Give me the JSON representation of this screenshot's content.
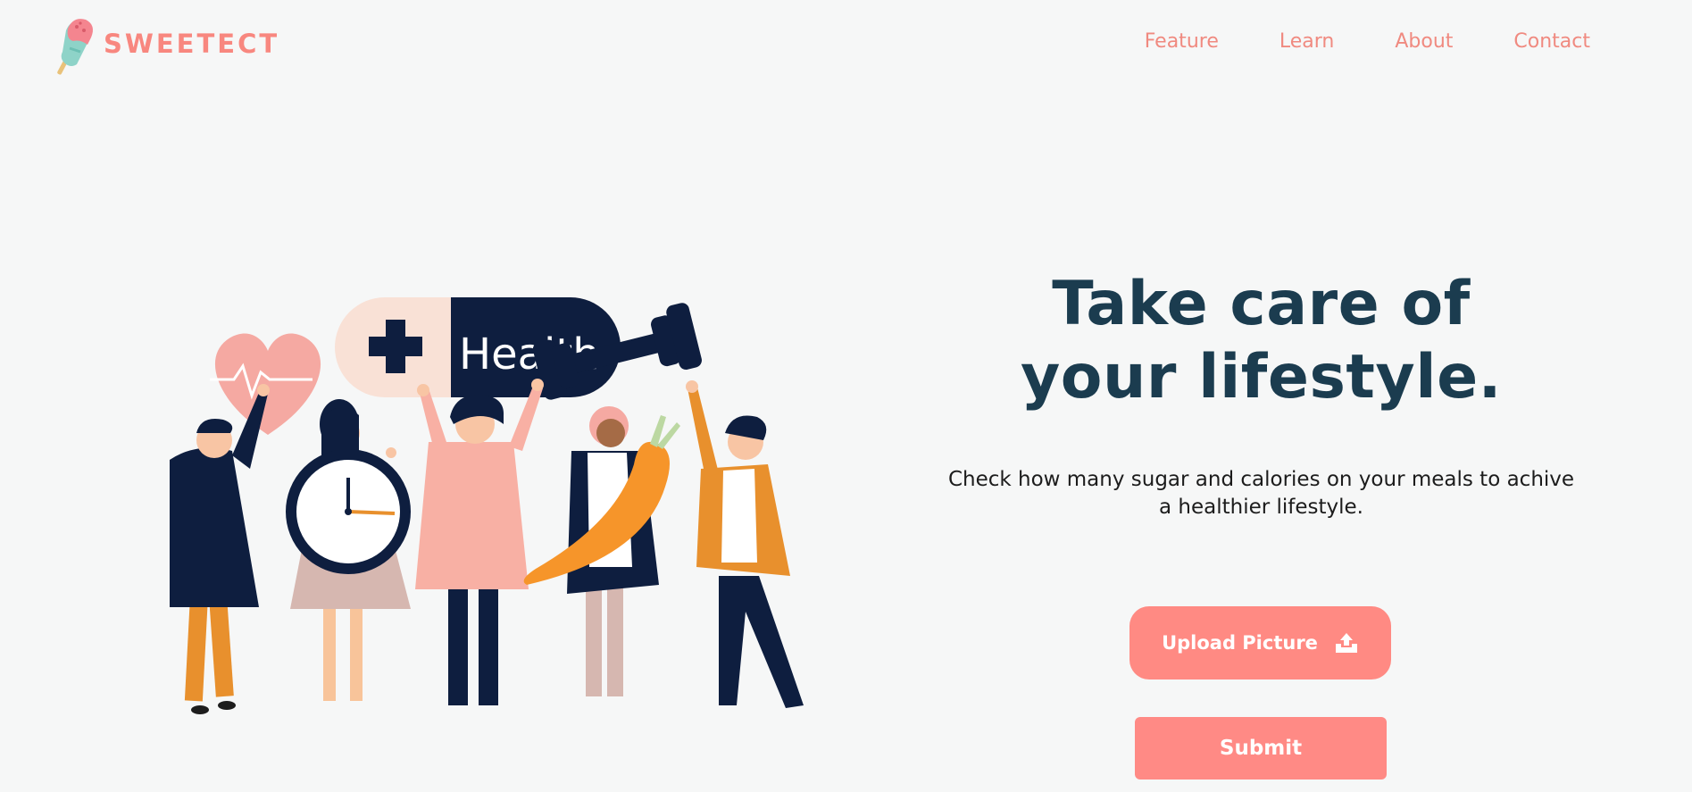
{
  "header": {
    "logo_text": "SWEETECT",
    "nav": [
      {
        "label": "Feature"
      },
      {
        "label": "Learn"
      },
      {
        "label": "About"
      },
      {
        "label": "Contact"
      }
    ]
  },
  "illustration": {
    "pill_label": "Health",
    "icons": [
      "heart-icon",
      "clock-icon",
      "dumbbell-icon",
      "carrot-icon",
      "plus-icon"
    ]
  },
  "hero": {
    "title_line1": "Take care of",
    "title_line2": "your lifestyle.",
    "description": "Check how many sugar and calories on your meals to achive a healthier lifestyle.",
    "upload_label": "Upload Picture",
    "submit_label": "Submit"
  },
  "colors": {
    "background": "#f6f7f7",
    "accent": "#ff8a83",
    "heading": "#1b3c4f",
    "navy": "#0e1e3f"
  }
}
